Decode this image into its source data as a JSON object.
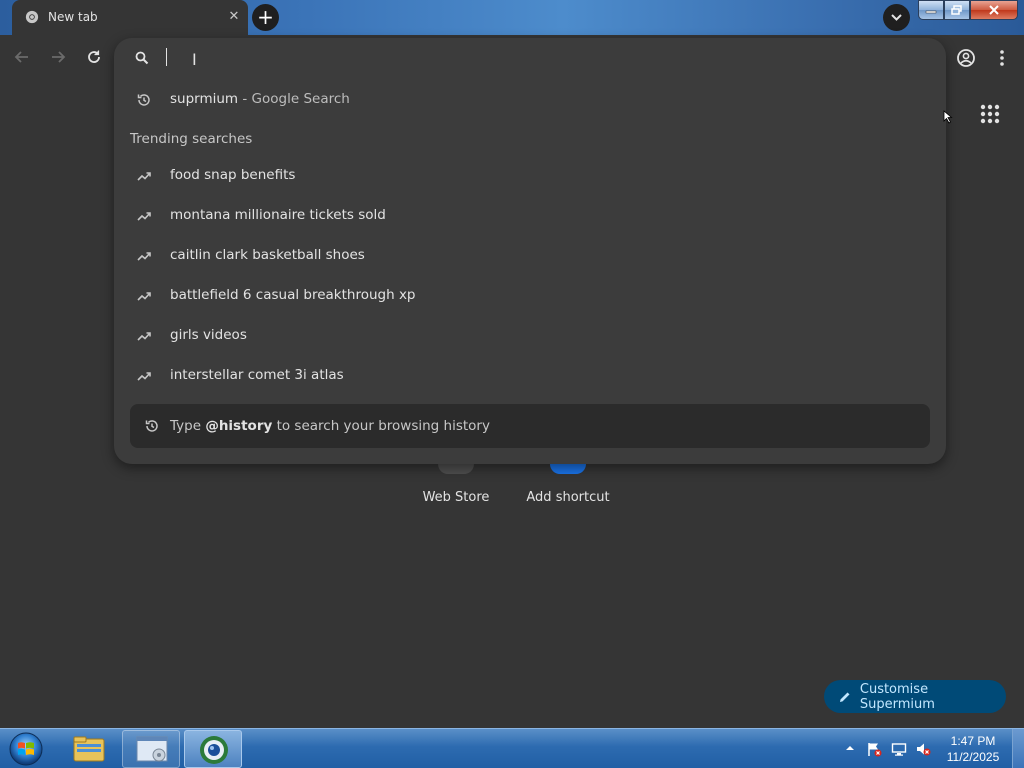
{
  "tab": {
    "title": "New tab",
    "close_glyph": "✕"
  },
  "omnibox": {
    "value": "",
    "first_suggestion": {
      "query": "suprmium",
      "source": " - Google Search"
    },
    "trending_header": "Trending searches",
    "trending": [
      "food snap benefits",
      "montana millionaire tickets sold",
      "caitlin clark basketball shoes",
      "battlefield 6 casual breakthrough xp",
      "girls videos",
      "interstellar comet 3i atlas"
    ],
    "history_hint": {
      "prefix": "Type ",
      "keyword": "@history",
      "suffix": " to search your browsing history"
    }
  },
  "shortcuts": [
    {
      "label": "Web Store"
    },
    {
      "label": "Add shortcut"
    }
  ],
  "customise_label": "Customise Supermium",
  "taskbar": {
    "time": "1:47 PM",
    "date": "11/2/2025"
  },
  "colors": {
    "accent": "#004a77",
    "accent_text": "#c2e7ff",
    "background": "#353535",
    "dropdown": "#3c3c3c"
  }
}
